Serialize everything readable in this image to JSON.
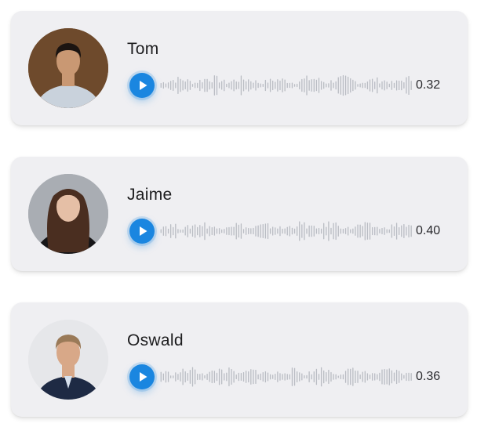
{
  "messages": [
    {
      "name": "Tom",
      "duration": "0.32",
      "play_icon": "play-icon",
      "accent": "#1a86e0",
      "avatar": {
        "bg": "#6e4a2c",
        "skin": "#c99873",
        "hair": "#1b1411",
        "shirt": "#c9d2dc"
      }
    },
    {
      "name": "Jaime",
      "duration": "0.40",
      "play_icon": "play-icon",
      "accent": "#1a86e0",
      "avatar": {
        "bg": "#a9adb3",
        "skin": "#e5bfa6",
        "hair": "#4a2e20",
        "shirt": "#161618"
      }
    },
    {
      "name": "Oswald",
      "duration": "0.36",
      "play_icon": "play-icon",
      "accent": "#1a86e0",
      "avatar": {
        "bg": "#e6e7ea",
        "skin": "#d8a888",
        "hair": "#9a7a58",
        "shirt": "#1e2a44"
      }
    }
  ]
}
